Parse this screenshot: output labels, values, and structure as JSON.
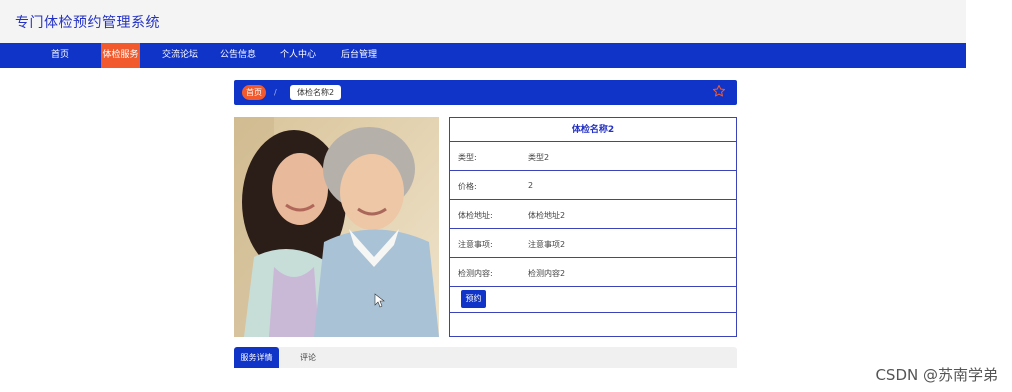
{
  "header": {
    "title": "专门体检预约管理系统"
  },
  "nav": {
    "items": [
      {
        "label": "首页"
      },
      {
        "label": "体检服务"
      },
      {
        "label": "交流论坛"
      },
      {
        "label": "公告信息"
      },
      {
        "label": "个人中心"
      },
      {
        "label": "后台管理"
      }
    ],
    "active": "体检服务"
  },
  "breadcrumb": {
    "home": "首页",
    "separator": "/",
    "current": "体检名称2"
  },
  "detail": {
    "title": "体检名称2",
    "fields": [
      {
        "label": "类型:",
        "value": "类型2"
      },
      {
        "label": "价格:",
        "value": "2"
      },
      {
        "label": "体检地址:",
        "value": "体检地址2"
      },
      {
        "label": "注意事项:",
        "value": "注意事项2"
      },
      {
        "label": "检测内容:",
        "value": "检测内容2"
      }
    ],
    "book_label": "预约"
  },
  "tabs": [
    {
      "label": "服务详情",
      "active": true
    },
    {
      "label": "评论",
      "active": false
    }
  ],
  "watermark": "CSDN @苏南学弟",
  "colors": {
    "primary": "#1134c8",
    "accent": "#f25a2d",
    "title": "#2432c4",
    "border": "#3b43b9"
  },
  "icons": {
    "favorite": "star-icon"
  }
}
